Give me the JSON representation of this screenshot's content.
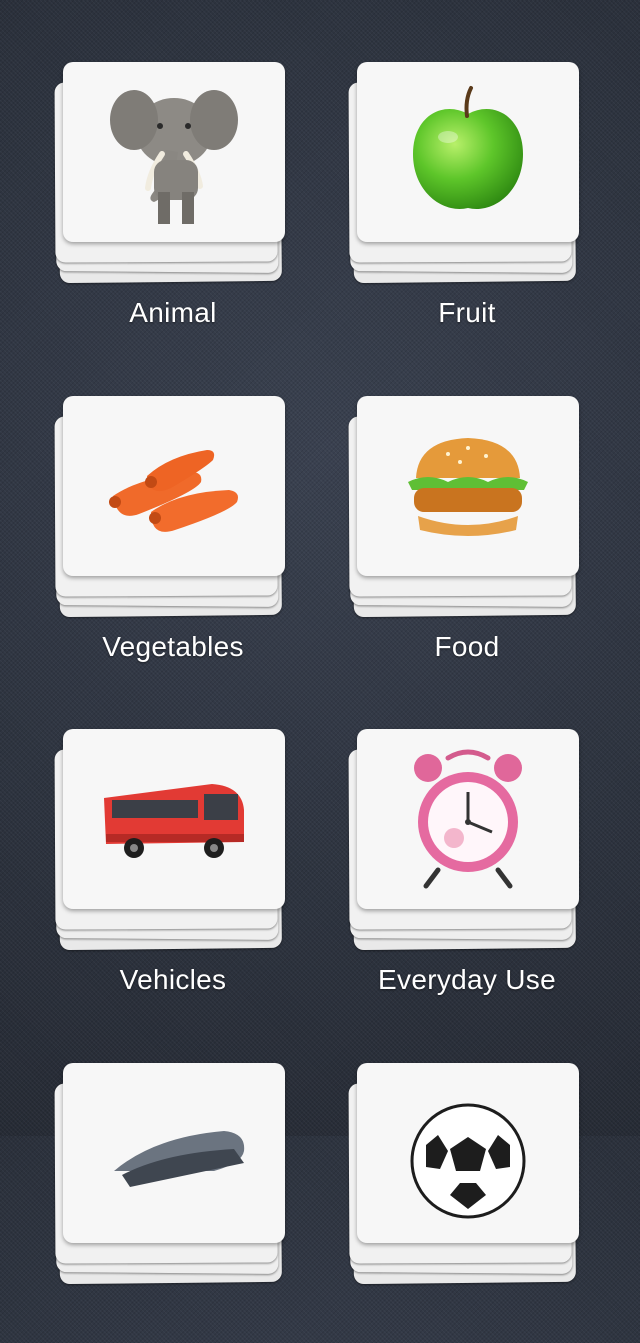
{
  "categories": [
    {
      "label": "Animal",
      "icon": "elephant-icon"
    },
    {
      "label": "Fruit",
      "icon": "apple-icon"
    },
    {
      "label": "Vegetables",
      "icon": "carrots-icon"
    },
    {
      "label": "Food",
      "icon": "burger-icon"
    },
    {
      "label": "Vehicles",
      "icon": "bus-icon"
    },
    {
      "label": "Everyday Use",
      "icon": "alarm-clock-icon"
    },
    {
      "label": "",
      "icon": "stapler-icon"
    },
    {
      "label": "",
      "icon": "soccer-ball-icon"
    }
  ]
}
